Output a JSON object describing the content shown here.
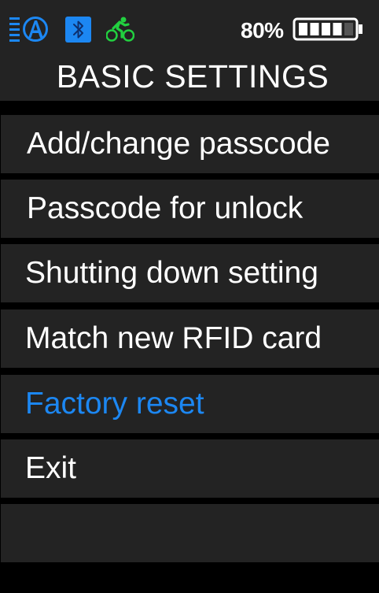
{
  "status_bar": {
    "assist_icon": "assist-mode-icon",
    "bluetooth_icon": "bluetooth-icon",
    "ride_icon": "cyclist-icon",
    "battery_percent": "80%",
    "battery_icon": "battery-icon",
    "battery_level_bars": 4,
    "battery_level_max": 5
  },
  "header": {
    "title": "BASIC SETTINGS"
  },
  "menu": {
    "items": [
      {
        "label": "Add/change passcode"
      },
      {
        "label": "Passcode for unlock"
      },
      {
        "label": "Shutting down setting"
      },
      {
        "label": "Match new RFID card"
      },
      {
        "label": "Factory reset",
        "selected": true
      },
      {
        "label": "Exit"
      },
      {
        "label": ""
      }
    ]
  },
  "colors": {
    "background": "#000000",
    "panel": "#232323",
    "text": "#ffffff",
    "accent": "#1c87f2",
    "status_green": "#22d040"
  }
}
